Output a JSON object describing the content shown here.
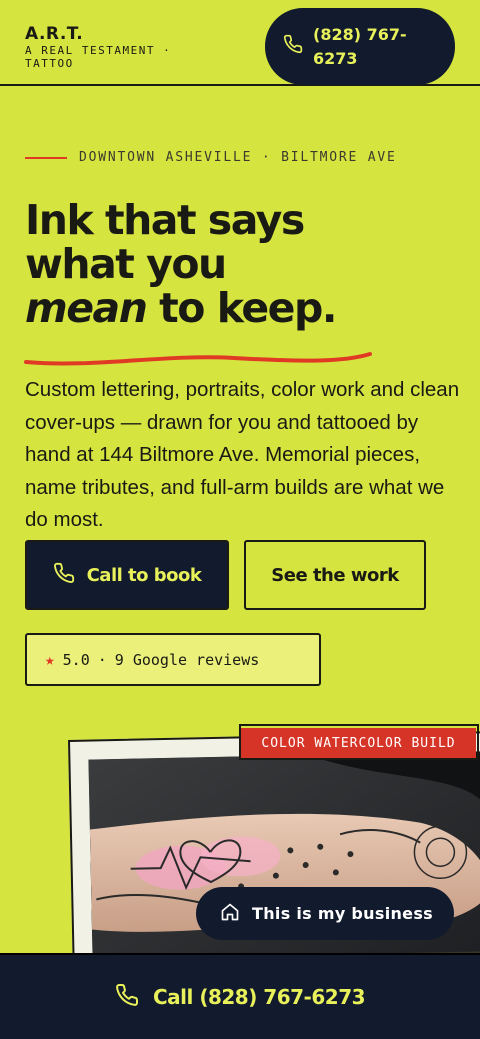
{
  "header": {
    "brand_name": "A.R.T.",
    "brand_sub": "A REAL TESTAMENT · TATTOO",
    "phone_label": "(828) 767-6273",
    "phone_icon": "phone-icon"
  },
  "hero": {
    "eyebrow": "DOWNTOWN ASHEVILLE · BILTMORE AVE",
    "headline_line1": "Ink that says",
    "headline_line2": "what you",
    "headline_em": "mean",
    "headline_line3_rest": " to keep.",
    "body": "Custom lettering, portraits, color work and clean cover-ups — drawn for you and tattooed by hand at 144 Biltmore Ave. Memorial pieces, name tributes, and full-arm builds are what we do most.",
    "cta_primary": "Call to book",
    "cta_secondary": "See the work",
    "rating": "5.0",
    "reviews": "9 Google reviews",
    "reviews_sep": "·"
  },
  "gallery": {
    "tag": "COLOR WATERCOLOR BUILD"
  },
  "business_pill": {
    "label": "This is my business",
    "icon": "home-icon"
  },
  "bottom_bar": {
    "label": "Call (828) 767-6273",
    "icon": "phone-icon"
  },
  "colors": {
    "background": "#d6e43f",
    "navy": "#121a2e",
    "accent_red": "#e03a25",
    "accent_yellow": "#e8f05a"
  }
}
